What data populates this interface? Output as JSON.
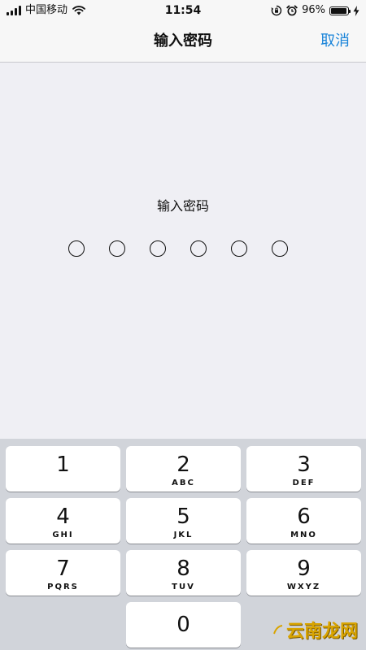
{
  "status_bar": {
    "carrier": "中国移动",
    "time": "11:54",
    "battery_percent": "96%",
    "battery_level": 0.96,
    "icons": [
      "signal-icon",
      "wifi-icon",
      "orientation-lock-icon",
      "alarm-icon",
      "battery-icon",
      "charging-icon"
    ]
  },
  "nav": {
    "title": "输入密码",
    "cancel_label": "取消",
    "accent_color": "#1a84d9"
  },
  "prompt": {
    "label": "输入密码",
    "digit_count": 6,
    "filled": 0
  },
  "keypad": {
    "keys": [
      {
        "digit": "1",
        "letters": ""
      },
      {
        "digit": "2",
        "letters": "ABC"
      },
      {
        "digit": "3",
        "letters": "DEF"
      },
      {
        "digit": "4",
        "letters": "GHI"
      },
      {
        "digit": "5",
        "letters": "JKL"
      },
      {
        "digit": "6",
        "letters": "MNO"
      },
      {
        "digit": "7",
        "letters": "PQRS"
      },
      {
        "digit": "8",
        "letters": "TUV"
      },
      {
        "digit": "9",
        "letters": "WXYZ"
      },
      {
        "digit": "0",
        "letters": ""
      }
    ]
  },
  "watermark": {
    "text": "云南龙网"
  }
}
